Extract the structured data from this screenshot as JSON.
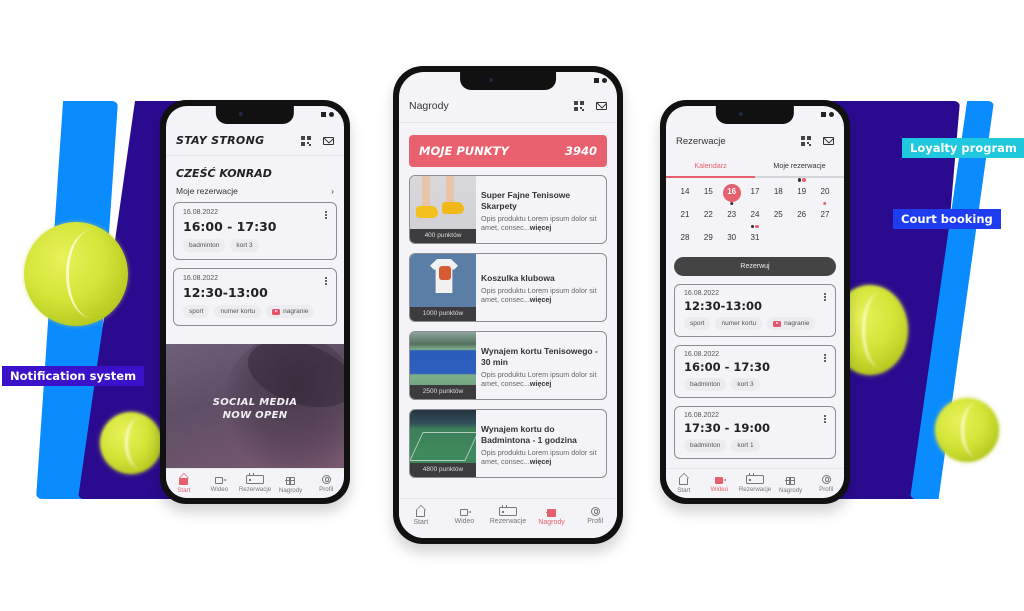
{
  "labels": {
    "notification": "Notification system",
    "loyalty": "Loyalty program",
    "court_booking": "Court booking"
  },
  "colors": {
    "accent": "#e5606f",
    "navy": "#2a0b8f",
    "blue": "#0a8cff",
    "cyan_tag": "#1fc8dc",
    "blue_tag": "#1f3df0",
    "purple_tag": "#3a12c9"
  },
  "nav": {
    "items": [
      {
        "label": "Start",
        "icon": "home-icon"
      },
      {
        "label": "Wideo",
        "icon": "video-icon"
      },
      {
        "label": "Rezerwacje",
        "icon": "calendar-icon"
      },
      {
        "label": "Nagrody",
        "icon": "gift-icon"
      },
      {
        "label": "Profil",
        "icon": "profile-icon"
      }
    ]
  },
  "phone_home": {
    "brand": "STAY STRONG",
    "greeting": "CZEŚĆ KONRAD",
    "section_title": "Moje rezerwacje",
    "section_chevron": "›",
    "reservations": [
      {
        "date": "16.08.2022",
        "time": "16:00 - 17:30",
        "chips": [
          "badminton",
          "kort 3"
        ]
      },
      {
        "date": "16.08.2022",
        "time": "12:30-13:00",
        "chips": [
          "sport",
          "numer kortu",
          "nagranie"
        ]
      }
    ],
    "promo": {
      "line1": "SOCIAL MEDIA",
      "line2": "NOW OPEN"
    },
    "active_tab": "Start"
  },
  "phone_rewards": {
    "title": "Nagrody",
    "points_label": "MOJE PUNKTY",
    "points_value": "3940",
    "products": [
      {
        "name": "Super Fajne Tenisowe Skarpety",
        "desc": "Opis produktu Lorem ipsum dolor sit amet, consec...",
        "more": "więcej",
        "points": "400 punktów"
      },
      {
        "name": "Koszulka klubowa",
        "desc": "Opis produktu Lorem ipsum dolor sit amet, consec...",
        "more": "więcej",
        "points": "1000 punktów"
      },
      {
        "name": "Wynajem kortu Tenisowego - 30 min",
        "desc": "Opis produktu Lorem ipsum dolor sit amet, consec...",
        "more": "więcej",
        "points": "2500 punktów"
      },
      {
        "name": "Wynajem kortu do Badmintona - 1 godzina",
        "desc": "Opis produktu Lorem ipsum dolor sit amet, consec...",
        "more": "więcej",
        "points": "4800 punktów"
      }
    ],
    "active_tab": "Nagrody"
  },
  "phone_booking": {
    "title": "Rezerwacje",
    "tabs": [
      "Kalendarz",
      "Moje rezerwacje"
    ],
    "active_subtab": "Kalendarz",
    "calendar": {
      "rows": [
        [
          "14",
          "15",
          "16",
          "17",
          "18",
          "19",
          "20"
        ],
        [
          "21",
          "22",
          "23",
          "24",
          "25",
          "26",
          "27"
        ],
        [
          "28",
          "29",
          "30",
          "31"
        ]
      ],
      "selected": "16"
    },
    "book_button": "Rezerwuj",
    "reservations": [
      {
        "date": "16.08.2022",
        "time": "12:30-13:00",
        "chips": [
          "sport",
          "numer kortu",
          "nagranie"
        ]
      },
      {
        "date": "16.08.2022",
        "time": "16:00 - 17:30",
        "chips": [
          "badminton",
          "kort 3"
        ]
      },
      {
        "date": "16.08.2022",
        "time": "17:30 - 19:00",
        "chips": [
          "badminton",
          "kort 1"
        ]
      }
    ],
    "active_tab": "Wideo"
  }
}
